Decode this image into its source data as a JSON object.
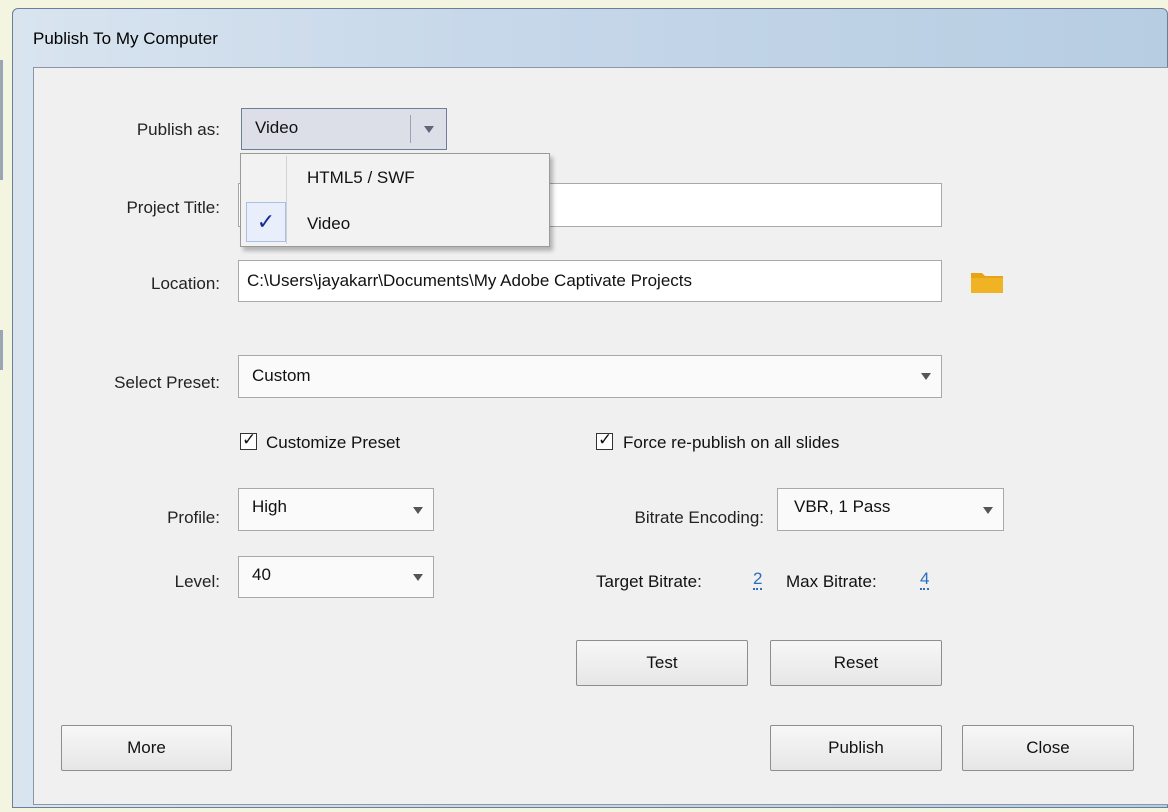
{
  "window": {
    "title": "Publish To My Computer"
  },
  "publish_as": {
    "label": "Publish as:",
    "selected": "Video",
    "options": [
      {
        "label": "HTML5 / SWF",
        "checked": false
      },
      {
        "label": "Video",
        "checked": true
      }
    ]
  },
  "project_title": {
    "label": "Project Title:",
    "value": ""
  },
  "location": {
    "label": "Location:",
    "value": "C:\\Users\\jayakarr\\Documents\\My Adobe Captivate Projects",
    "browse_icon": "folder-icon"
  },
  "preset": {
    "label": "Select Preset:",
    "selected": "Custom"
  },
  "customize_preset": {
    "label": "Customize Preset",
    "checked": true
  },
  "force_republish": {
    "label": "Force re-publish on all slides",
    "checked": true
  },
  "profile": {
    "label": "Profile:",
    "selected": "High"
  },
  "level": {
    "label": "Level:",
    "selected": "40"
  },
  "bitrate_encoding": {
    "label": "Bitrate Encoding:",
    "selected": "VBR, 1 Pass"
  },
  "target_bitrate": {
    "label": "Target Bitrate:",
    "value": "2"
  },
  "max_bitrate": {
    "label": "Max Bitrate:",
    "value": "4"
  },
  "buttons": {
    "test": "Test",
    "reset": "Reset",
    "more": "More",
    "publish": "Publish",
    "close": "Close"
  },
  "colors": {
    "link": "#2a6fbf",
    "folder": "#e8a317",
    "check_highlight": "#e8eefa"
  }
}
